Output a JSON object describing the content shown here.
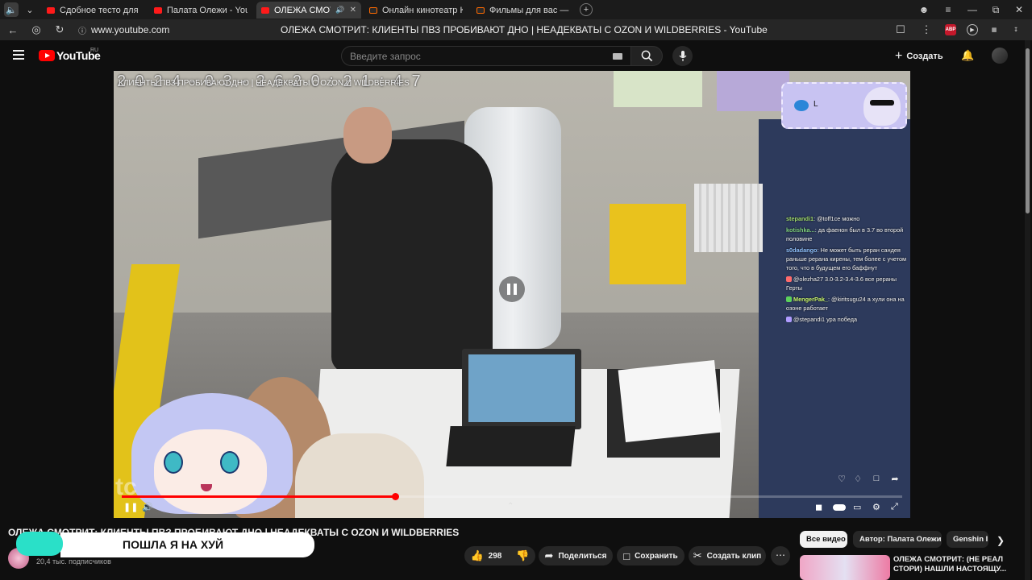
{
  "browser": {
    "tabs": [
      {
        "title": "Сдобное тесто для ИДЕА",
        "favicon": "youtube-icon"
      },
      {
        "title": "Палата Олежи - YouTube",
        "favicon": "youtube-icon"
      },
      {
        "title": "ОЛЕЖА СМОТРИТ:",
        "favicon": "youtube-icon",
        "active": true,
        "audio": true
      },
      {
        "title": "Онлайн кинотеатр Кинот",
        "favicon": "kinopoisk-icon"
      },
      {
        "title": "Фильмы для вас — смотр",
        "favicon": "kinopoisk-icon"
      }
    ],
    "url": "www.youtube.com",
    "page_title": "ОЛЕЖА СМОТРИТ: КЛИЕНТЫ ПВЗ ПРОБИВАЮТ ДНО | НЕАДЕКВАТЫ С OZON И WILDBERRIES - YouTube",
    "extension_abp": "ABP"
  },
  "header": {
    "logo_text": "YouTube",
    "logo_region": "RU",
    "search_placeholder": "Введите запрос",
    "create_label": "Создать"
  },
  "player": {
    "timestamp_overlay": "2 0 2 4 - 0 3 - 2 6   2 0 : 2 1 : 4 7",
    "overlay_title": "КЛИЕНТЫ ПВЗ ПРОБИВАЮТ ДНО | НЕАДЕКВАТЫ С OZON И WILDBERRIES",
    "stream_card_letter": "L",
    "watermark": "tc",
    "progress_fraction": 0.35,
    "chat": [
      {
        "user": "stepandi1",
        "text": ": @toff1ce можно",
        "color": "#9fd86b"
      },
      {
        "user": "kotishka...",
        "text": ": да фаенон был в 3.7 во второй половине",
        "color": "#7fd17f"
      },
      {
        "user": "s0dadango",
        "text": ": Не может быть реран сандея раньше рерана кирены, тем более с учетом того, что в будущем его баффнут",
        "color": "#8fc2ff"
      },
      {
        "user": "",
        "text": "@olezha27 3.0-3.2-3.4-3.6 все рераны Герты",
        "color": "#ff6b6b"
      },
      {
        "user": "MengerPak_",
        "text": ": @kiritsugu24 а хули она на озоне работает",
        "color": "#c8f56b"
      },
      {
        "user": "",
        "text": "@stepandi1 ура победа",
        "color": "#b09cff"
      }
    ]
  },
  "video": {
    "title": "ОЛЕЖА СМОТРИТ: КЛИЕНТЫ ПВЗ ПРОБИВАЮТ ДНО | НЕАДЕКВАТЫ С OZON И WILDBERRIES",
    "subscribers": "20,4 тыс. подписчиков",
    "caption": "ПОШЛА Я НА ХУЙ",
    "likes": "298",
    "share_label": "Поделиться",
    "save_label": "Сохранить",
    "clip_label": "Создать клип"
  },
  "sidebar": {
    "chips": [
      "Все видео",
      "Автор: Палата Олежи",
      "Genshin I"
    ],
    "rec_title": "ОЛЕЖА СМОТРИТ: (НЕ РЕАЛ СТОРИ) НАШЛИ НАСТОЯЩУ..."
  }
}
